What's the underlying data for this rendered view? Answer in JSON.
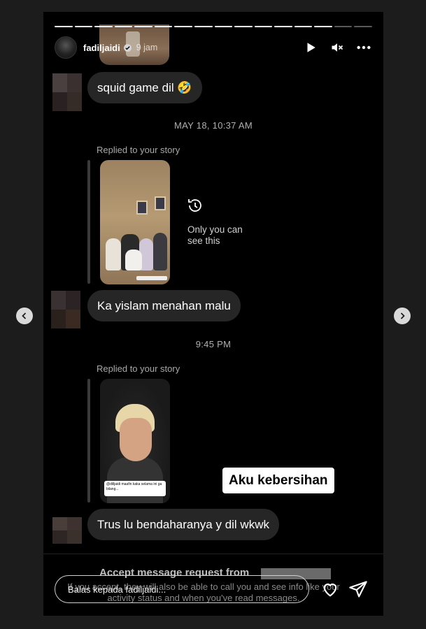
{
  "header": {
    "username": "fadiljaidi",
    "time_ago": "9 jam"
  },
  "story_progress": {
    "total_segments": 16,
    "current_segment": 15
  },
  "icons": {
    "verified": "verified-badge-icon",
    "play": "play-icon",
    "mute": "mute-icon",
    "more": "more-icon",
    "history": "history-icon",
    "like": "heart-icon",
    "send": "send-icon",
    "prev": "chevron-left-icon",
    "next": "chevron-right-icon"
  },
  "messages": [
    {
      "text": "squid game dil 🤣"
    },
    {
      "timestamp": "MAY 18, 10:37 AM",
      "replied_label": "Replied to your story",
      "only_you_text": "Only you can see this",
      "text": "Ka yislam menahan malu"
    },
    {
      "timestamp": "9:45 PM",
      "replied_label": "Replied to your story",
      "story_caption": "@dilljaidi maafin kaka selama ini ga bilang...",
      "text": "Trus lu bendaharanya y dil wkwk"
    }
  ],
  "sticker_text": "Aku kebersihan",
  "request": {
    "title": "Accept message request from",
    "body": "If you accept, they will also be able to call you and see info like your activity status and when you've read messages."
  },
  "reply": {
    "placeholder": "Balas kepada fadiljaidi..."
  },
  "colors": {
    "background": "#1c1c1c",
    "story": "#000000",
    "bubble": "#262626",
    "sticker_bg": "#ffffff"
  }
}
